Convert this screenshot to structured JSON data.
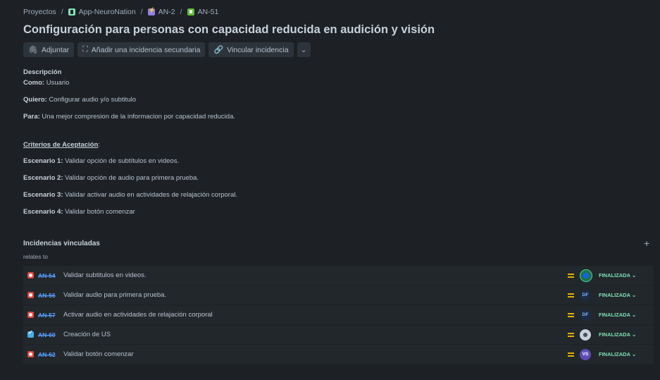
{
  "breadcrumb": {
    "root": "Proyectos",
    "project": "App-NeuroNation",
    "epic": "AN-2",
    "issue": "AN-51"
  },
  "title": "Configuración para personas con capacidad reducida en audición y visión",
  "toolbar": {
    "attach": "Adjuntar",
    "add_child": "Añadir una incidencia secundaria",
    "link": "Vincular incidencia"
  },
  "description": {
    "heading": "Descripción",
    "como_label": "Como:",
    "como": " Usuario",
    "quiero_label": "Quiero:",
    "quiero": " Configurar audio y/o subtitulo",
    "para_label": "Para:",
    "para": " Una mejor compresion de la informacion por capacidad reducida.",
    "criteria_label": "Criterios de Aceptación",
    "criteria_colon": ":",
    "scenarios": [
      {
        "label": "Escenario 1:",
        "text": " Validar opción de subtítulos en videos."
      },
      {
        "label": "Escenario 2:",
        "text": " Validar opción de audio para primera prueba."
      },
      {
        "label": "Escenario 3:",
        "text": " Validar activar audio en actividades de relajación corporal."
      },
      {
        "label": "Escenario 4:",
        "text": " Validar botón comenzar"
      }
    ]
  },
  "linked": {
    "title": "Incidencias vinculadas",
    "add": "+",
    "relation": "relates to",
    "issues": [
      {
        "type": "bug",
        "key": "AN-54",
        "summary": "Validar subtitulos en videos.",
        "avatar": "",
        "avatar_kind": "img",
        "status": "FINALIZADA"
      },
      {
        "type": "bug",
        "key": "AN-56",
        "summary": "Validar audio para primera prueba.",
        "avatar": "DF",
        "avatar_kind": "df",
        "status": "FINALIZADA"
      },
      {
        "type": "bug",
        "key": "AN-57",
        "summary": "Activar audio en actividades de relajación corporal",
        "avatar": "DF",
        "avatar_kind": "df",
        "status": "FINALIZADA"
      },
      {
        "type": "task",
        "key": "AN-60",
        "summary": "Creación de US",
        "avatar": "",
        "avatar_kind": "gen",
        "status": "FINALIZADA"
      },
      {
        "type": "bug",
        "key": "AN-62",
        "summary": "Validar botón comenzar",
        "avatar": "VS",
        "avatar_kind": "vs",
        "status": "FINALIZADA"
      }
    ]
  },
  "colors": {
    "background": "#1d2125",
    "row": "#22272b",
    "link": "#579dff",
    "status": "#7ee2b8",
    "priority": "#e2b203"
  }
}
